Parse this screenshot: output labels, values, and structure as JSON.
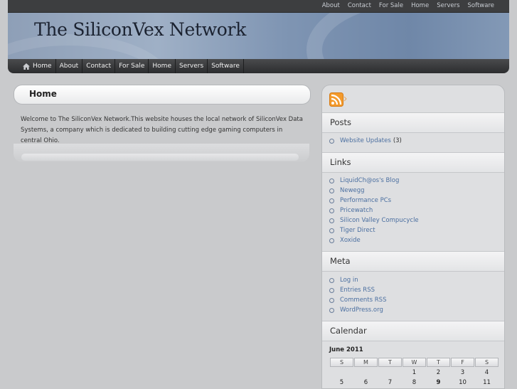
{
  "topbar": {
    "links": [
      "About",
      "Contact",
      "For Sale",
      "Home",
      "Servers",
      "Software"
    ]
  },
  "header": {
    "site_title": "The SiliconVex Network"
  },
  "nav": {
    "items": [
      "Home",
      "About",
      "Contact",
      "For Sale",
      "Home",
      "Servers",
      "Software"
    ]
  },
  "post": {
    "title": "Home",
    "body": "Welcome to The SiliconVex Network.This website houses the local network of SiliconVex Data Systems, a company which is dedicated to building cutting edge gaming computers in central Ohio."
  },
  "sidebar": {
    "rss_icon": "rss-feed-icon",
    "posts": {
      "heading": "Posts",
      "items": [
        {
          "label": "Website Updates",
          "count": "(3)"
        }
      ]
    },
    "links": {
      "heading": "Links",
      "items": [
        "LiquidCh@os's Blog",
        "Newegg",
        "Performance PCs",
        "Pricewatch",
        "Silicon Valley Compucycle",
        "Tiger Direct",
        "Xoxide"
      ]
    },
    "meta": {
      "heading": "Meta",
      "items": [
        "Log in",
        "Entries RSS",
        "Comments RSS",
        "WordPress.org"
      ]
    },
    "calendar": {
      "heading": "Calendar",
      "caption": "June 2011",
      "days": [
        "S",
        "M",
        "T",
        "W",
        "T",
        "F",
        "S"
      ],
      "rows": [
        [
          "",
          "",
          "",
          "1",
          "2",
          "3",
          "4"
        ],
        [
          "5",
          "6",
          "7",
          "8",
          "9",
          "10",
          "11"
        ]
      ],
      "today": "9"
    }
  },
  "colors": {
    "link": "#4b6fa0",
    "nav_bg": "#2c2d2f",
    "page_bg": "#c9cacc",
    "rss": "#f39a2c"
  }
}
